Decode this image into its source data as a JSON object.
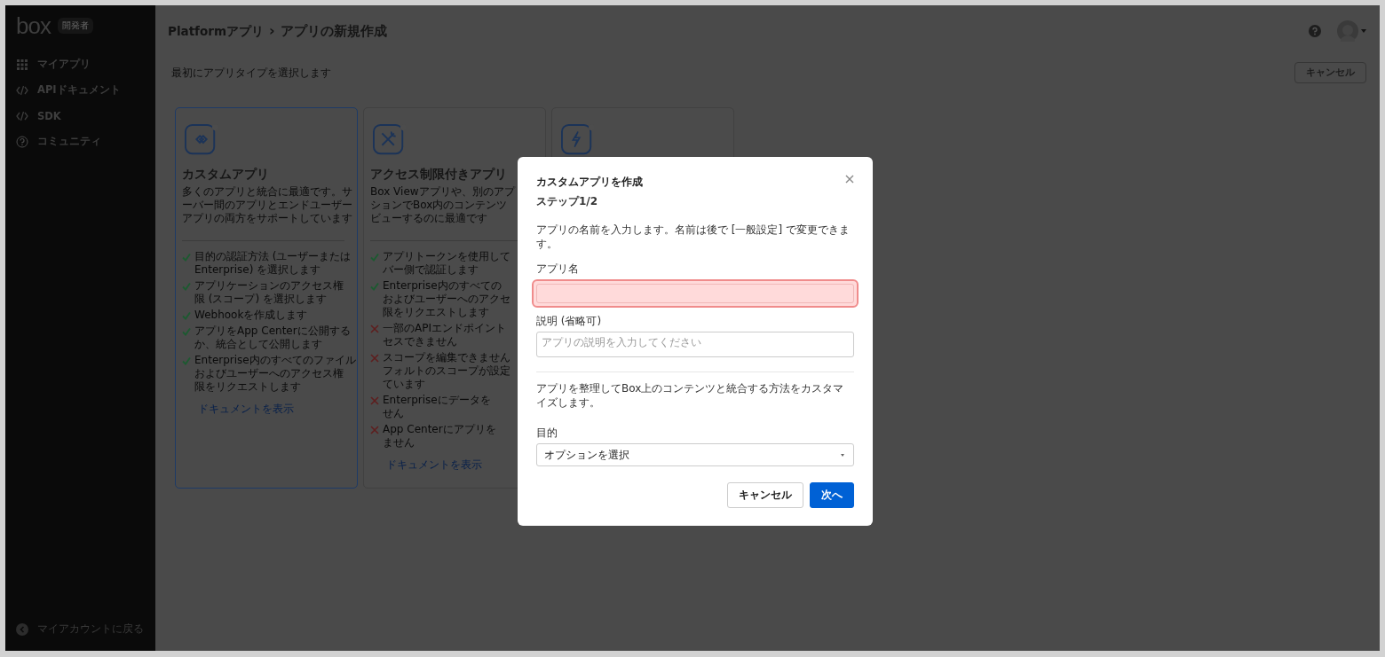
{
  "sidebar": {
    "logo": "box",
    "badge": "開発者",
    "items": [
      {
        "kind": "grid",
        "label": "マイアプリ"
      },
      {
        "kind": "code",
        "label": "APIドキュメント"
      },
      {
        "kind": "code",
        "label": "SDK"
      },
      {
        "kind": "help",
        "label": "コミュニティ"
      }
    ],
    "footer_link": "マイアカウントに戻る"
  },
  "header": {
    "breadcrumb_parent": "Platformアプリ",
    "breadcrumb_separator": "›",
    "title": "アプリの新規作成"
  },
  "subtitle": "最初にアプリタイプを選択します",
  "cancel_button": "キャンセル",
  "cards": [
    {
      "kind": "custom",
      "selected": true,
      "title": "カスタムアプリ",
      "description": [
        "多くのアプリと統合に最適です。サ",
        "ーバー間のアプリとエンドユーザー",
        "アプリの両方をサポートしています"
      ],
      "features": [
        {
          "kind": "check",
          "lines": [
            "目的の認証方法 (ユーザーまたは",
            "Enterprise) を選択します"
          ]
        },
        {
          "kind": "check",
          "lines": [
            "アプリケーションのアクセス権",
            "限 (スコープ) を選択します"
          ]
        },
        {
          "kind": "check",
          "lines": [
            "Webhookを作成します"
          ]
        },
        {
          "kind": "check",
          "lines": [
            "アプリをApp Centerに公開する",
            "か、統合として公開します"
          ]
        },
        {
          "kind": "check",
          "lines": [
            "Enterprise内のすべてのファイル",
            "およびユーザーへのアクセス権",
            "限をリクエストします"
          ]
        }
      ],
      "link": "ドキュメントを表示"
    },
    {
      "kind": "limited",
      "selected": false,
      "title": "アクセス制限付きアプリ",
      "description": [
        "Box Viewアプリや、別のアプ",
        "ションでBox内のコンテンツ",
        "ビューするのに最適です"
      ],
      "features": [
        {
          "kind": "check",
          "lines": [
            "アプリトークンを使用して",
            "バー側で認証します"
          ]
        },
        {
          "kind": "check",
          "lines": [
            "Enterprise内のすべての",
            "およびユーザーへのアクセ",
            "限をリクエストします"
          ]
        },
        {
          "kind": "cross",
          "lines": [
            "一部のAPIエンドポイント",
            "セスできません"
          ]
        },
        {
          "kind": "cross",
          "lines": [
            "スコープを編集できません",
            "フォルトのスコープが設定",
            "ています"
          ]
        },
        {
          "kind": "cross",
          "lines": [
            "Enterpriseにデータを",
            "せん"
          ]
        },
        {
          "kind": "cross",
          "lines": [
            "App Centerにアプリを",
            "ません"
          ]
        }
      ],
      "link": "ドキュメントを表示"
    },
    {
      "kind": "bolt",
      "selected": false
    }
  ],
  "dialog": {
    "title": "カスタムアプリを作成",
    "step": "ステップ1/2",
    "intro": "アプリの名前を入力します。名前は後で [一般設定] で変更できます。",
    "name_label": "アプリ名",
    "name_highlighted": true,
    "description_label": "説明 (省略可)",
    "description_placeholder": "アプリの説明を入力してください",
    "purpose_text": "アプリを整理してBox上のコンテンツと統合する方法をカスタマイズします。",
    "purpose_label": "目的",
    "purpose_select": "オプションを選択",
    "buttons": [
      {
        "kind": "secondary",
        "label": "キャンセル"
      },
      {
        "kind": "primary",
        "label": "次へ"
      }
    ]
  }
}
